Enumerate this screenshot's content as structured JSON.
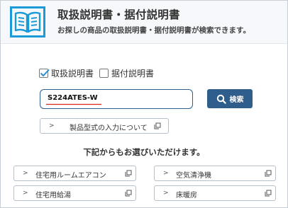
{
  "header": {
    "icon": "manual-book-icon",
    "title": "取扱説明書・据付説明書",
    "subtitle": "お探しの商品の取扱説明書・据付説明書が検索できます。"
  },
  "filters": [
    {
      "label": "取扱説明書",
      "checked": true
    },
    {
      "label": "据付説明書",
      "checked": false
    }
  ],
  "search": {
    "value": "S224ATES-W",
    "button_label": "検索",
    "button_icon": "search-icon"
  },
  "model_help_link": {
    "label": "製品型式の入力について",
    "icon": "external-window-icon"
  },
  "categories_title": "下記からもお選びいただけます。",
  "categories": [
    {
      "label": "住宅用ルームエアコン"
    },
    {
      "label": "空気清浄機"
    },
    {
      "label": "住宅用給湯"
    },
    {
      "label": "床暖房"
    }
  ],
  "colors": {
    "brand": "#2f5d8c",
    "icon_blue": "#1a9ad6",
    "checkbox_check": "#2a8fd0",
    "spell_error": "#d9251d"
  }
}
